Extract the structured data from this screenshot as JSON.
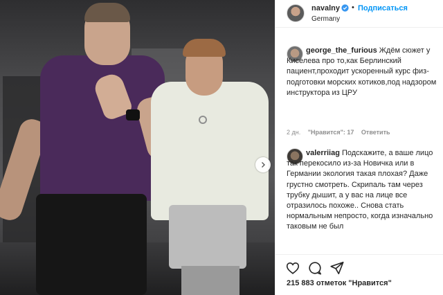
{
  "post": {
    "media_alt": "Two men walking in a gym",
    "carousel_next_icon": "chevron-right-icon"
  },
  "header": {
    "username": "navalny",
    "verified_icon": "verified-badge-icon",
    "separator": "•",
    "follow_label": "Подписаться",
    "location": "Germany",
    "follow_color": "#0095f6"
  },
  "comments": [
    {
      "username": "george_the_furious",
      "text": "Ждём сюжет у Киселева про то,как Берлинский пациент,проходит ускоренный курс физ-подготовки морских котиков,под надзором инструктора из ЦРУ",
      "time": "2 дн.",
      "likes": "\"Нравится\": 17",
      "reply": "Ответить"
    },
    {
      "username": "valerriiag",
      "text": "Подскажите, а ваше лицо так перекосило из-за Новичка или в Германии экология такая плохая? Даже грустно смотреть. Скрипаль там через трубку дышит, а у вас на лице все отразилось похоже.. Снова стать нормальным непросто, когда изначально таковым не был"
    }
  ],
  "actions": {
    "like_icon": "heart-icon",
    "comment_icon": "comment-bubble-icon",
    "share_icon": "paper-plane-icon"
  },
  "likes_text": "215 883 отметок \"Нравится\""
}
